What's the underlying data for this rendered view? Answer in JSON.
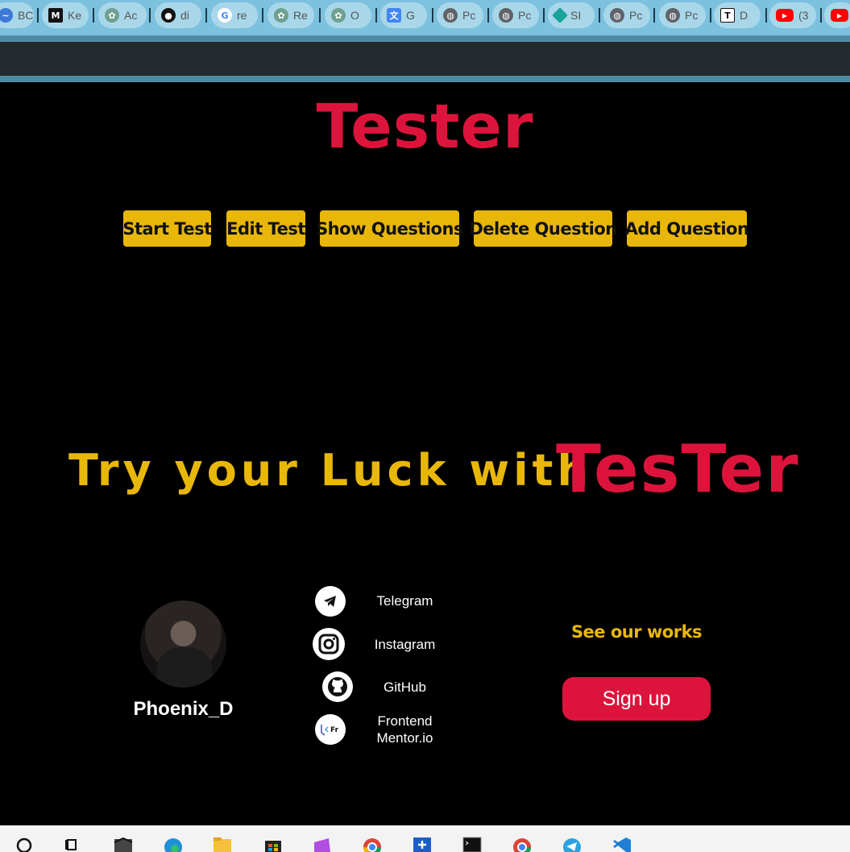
{
  "browser": {
    "tabs": [
      {
        "title": "BC",
        "icon": "wavy-icon",
        "color": "#3b78d8"
      },
      {
        "title": "Ke",
        "icon": "medium-icon",
        "color": "#111111"
      },
      {
        "title": "Ac",
        "icon": "openai-icon",
        "color": "#6e9f8f"
      },
      {
        "title": "di",
        "icon": "github-icon",
        "color": "#111111"
      },
      {
        "title": "re",
        "icon": "google-icon",
        "color": "#4285f4"
      },
      {
        "title": "Re",
        "icon": "openai-icon",
        "color": "#6e9f8f"
      },
      {
        "title": "O",
        "icon": "openai-icon",
        "color": "#6e9f8f"
      },
      {
        "title": "G",
        "icon": "translate-icon",
        "color": "#4285f4"
      },
      {
        "title": "Pc",
        "icon": "globe-icon",
        "color": "#5f6368"
      },
      {
        "title": "Pc",
        "icon": "globe-icon",
        "color": "#5f6368"
      },
      {
        "title": "SI",
        "icon": "diamond-icon",
        "color": "#1aa39a"
      },
      {
        "title": "Pc",
        "icon": "globe-icon",
        "color": "#5f6368"
      },
      {
        "title": "Pc",
        "icon": "globe-icon",
        "color": "#5f6368"
      },
      {
        "title": "D",
        "icon": "t-icon",
        "color": "#111111"
      },
      {
        "title": "(3",
        "icon": "youtube-icon",
        "color": "#ff0000"
      },
      {
        "title": "",
        "icon": "youtube-icon",
        "color": "#ff0000"
      }
    ]
  },
  "page": {
    "title": "Tester",
    "nav": [
      {
        "label": "Start Test"
      },
      {
        "label": "Edit Test"
      },
      {
        "label": "Show Questions"
      },
      {
        "label": "Delete Question"
      },
      {
        "label": "Add Question"
      }
    ],
    "tagline": "Try your Luck with",
    "brand": "TesTer"
  },
  "footer": {
    "username": "Phoenix_D",
    "socials": [
      {
        "label": "Telegram",
        "icon": "telegram-icon"
      },
      {
        "label": "Instagram",
        "icon": "instagram-icon"
      },
      {
        "label": "GitHub",
        "icon": "github-icon"
      },
      {
        "label_line1": "Frontend",
        "label_line2": "Mentor.io",
        "icon": "frontend-mentor-icon"
      }
    ],
    "works_label": "See our works",
    "signup_label": "Sign up"
  },
  "colors": {
    "accent_yellow": "#e8b70a",
    "accent_red": "#dc143c",
    "background": "#000000"
  },
  "taskbar": {
    "icons": [
      "search-icon",
      "task-view-icon",
      "mail-icon",
      "edge-icon",
      "file-explorer-icon",
      "store-icon",
      "media-icon",
      "chrome-icon",
      "calculator-icon",
      "terminal-icon",
      "chrome-profile-icon",
      "telegram-icon",
      "vscode-icon"
    ]
  }
}
